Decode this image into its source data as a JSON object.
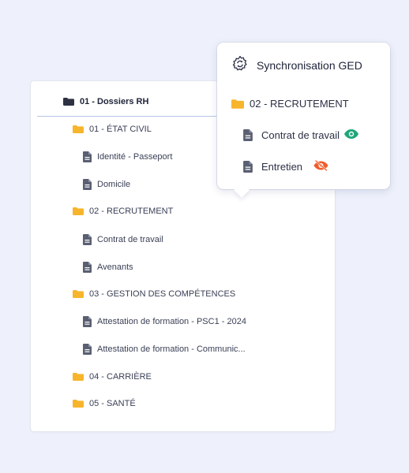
{
  "colors": {
    "background": "#eef1fb",
    "folder": "#f7b52c",
    "root_folder": "#2d3142",
    "doc": "#5a5f72",
    "eye_visible": "#1fa67a",
    "eye_hidden": "#f25c2b"
  },
  "tree": {
    "root": {
      "label": "01 - Dossiers RH",
      "icon": "folder-dark-icon"
    },
    "items": [
      {
        "type": "folder",
        "label": "01 - ÉTAT CIVIL"
      },
      {
        "type": "doc",
        "label": "Identité - Passeport"
      },
      {
        "type": "doc",
        "label": "Domicile"
      },
      {
        "type": "folder",
        "label": "02 - RECRUTEMENT"
      },
      {
        "type": "doc",
        "label": "Contrat de travail"
      },
      {
        "type": "doc",
        "label": "Avenants"
      },
      {
        "type": "folder",
        "label": "03 - GESTION DES COMPÉTENCES"
      },
      {
        "type": "doc",
        "label": "Attestation de formation - PSC1 - 2024"
      },
      {
        "type": "doc",
        "label": "Attestation de formation - Communic..."
      },
      {
        "type": "folder",
        "label": "04 - CARRIÈRE"
      },
      {
        "type": "folder",
        "label": "05 - SANTÉ"
      }
    ]
  },
  "popup": {
    "title": "Synchronisation GED",
    "title_icon": "sync-gear-icon",
    "folder": {
      "label": "02 - RECRUTEMENT"
    },
    "docs": [
      {
        "label": "Contrat de travail",
        "status_icon": "eye-icon",
        "visible": true
      },
      {
        "label": "Entretien",
        "status_icon": "eye-slash-icon",
        "visible": false
      }
    ]
  }
}
